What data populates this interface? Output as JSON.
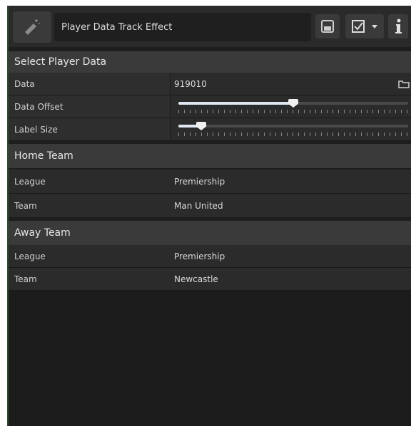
{
  "header": {
    "title": "Player Data Track Effect",
    "icons": [
      "effect-icon",
      "save-icon",
      "checkbox-icon",
      "dropdown-caret-icon",
      "info-icon"
    ]
  },
  "sections": {
    "select_player_data": "Select Player Data",
    "home_team": "Home Team",
    "away_team": "Away Team"
  },
  "player_data": {
    "data_label": "Data",
    "data_value": "919010",
    "offset_label": "Data Offset",
    "offset_value": 0.5,
    "label_size_label": "Label Size",
    "label_size_value": 0.1
  },
  "home": {
    "league_label": "League",
    "league_value": "Premiership",
    "team_label": "Team",
    "team_value": "Man United"
  },
  "away": {
    "league_label": "League",
    "league_value": "Premiership",
    "team_label": "Team",
    "team_value": "Newcastle"
  },
  "colors": {
    "panel": "#1e1e1e",
    "section": "#3a3a3a",
    "row": "#2b2b2b",
    "slider_fill": "#dfe8f2"
  }
}
